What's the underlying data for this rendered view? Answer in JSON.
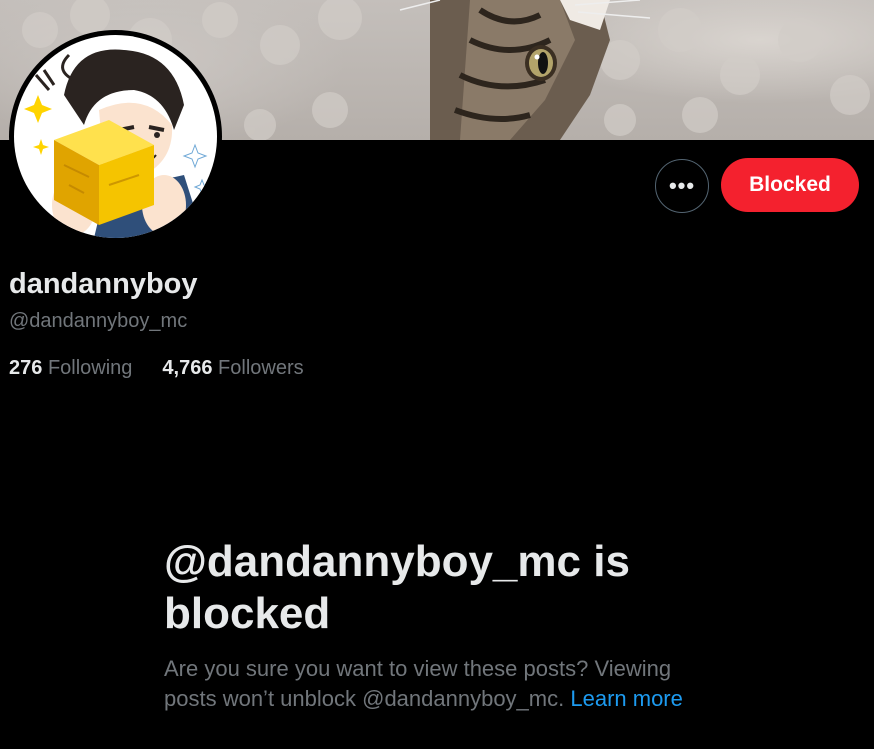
{
  "banner": {
    "description": "cat-photo-banner"
  },
  "profile": {
    "display_name": "dandannyboy",
    "handle": "@dandannyboy_mc",
    "following_count": "276",
    "following_label": "Following",
    "followers_count": "4,766",
    "followers_label": "Followers"
  },
  "actions": {
    "more_label": "•••",
    "blocked_label": "Blocked"
  },
  "blocked_notice": {
    "title_line1": "@dandannyboy_mc is",
    "title_line2": "blocked",
    "description": "Are you sure you want to view these posts? Viewing posts won’t unblock @dandannyboy_mc.",
    "learn_more": "Learn more"
  },
  "colors": {
    "background": "#000000",
    "primary_text": "#e7e9ea",
    "secondary_text": "#71767b",
    "blocked_button": "#f4212e",
    "link": "#1d9bf0"
  }
}
